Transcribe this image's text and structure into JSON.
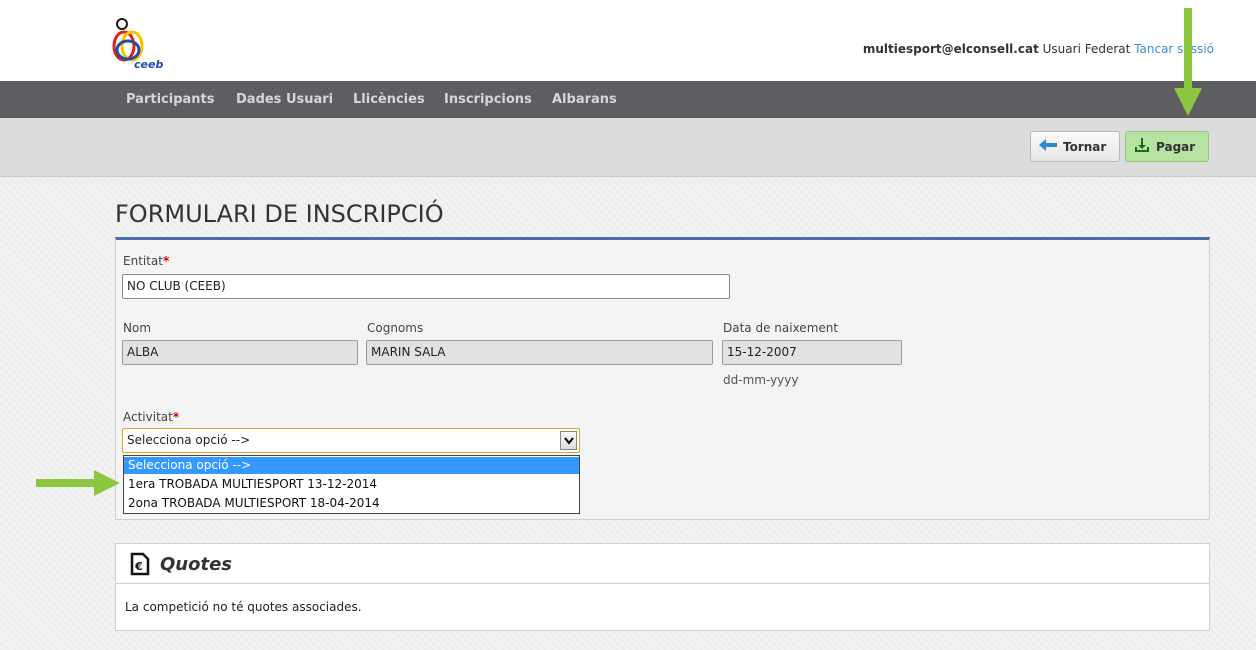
{
  "header": {
    "logo_text": "ceeb",
    "email": "multiesport@elconsell.cat",
    "role": "Usuari Federat",
    "logout_label": "Tancar sessió"
  },
  "nav": {
    "items": [
      {
        "label": "Participants"
      },
      {
        "label": "Dades Usuari"
      },
      {
        "label": "Llicències"
      },
      {
        "label": "Inscripcions"
      },
      {
        "label": "Albarans"
      }
    ]
  },
  "toolbar": {
    "back_label": "Tornar",
    "pay_label": "Pagar"
  },
  "page": {
    "title": "FORMULARI DE INSCRIPCIÓ"
  },
  "form": {
    "entitat": {
      "label": "Entitat",
      "required_mark": "*",
      "value": "NO CLUB (CEEB)"
    },
    "nom": {
      "label": "Nom",
      "value": "ALBA"
    },
    "cognoms": {
      "label": "Cognoms",
      "value": "MARIN SALA"
    },
    "data_naixement": {
      "label": "Data de naixement",
      "value": "15-12-2007",
      "hint": "dd-mm-yyyy"
    },
    "activitat": {
      "label": "Activitat",
      "required_mark": "*",
      "selected": "Selecciona opció -->",
      "options": [
        {
          "label": "Selecciona opció -->"
        },
        {
          "label": "1era TROBADA MULTIESPORT 13-12-2014"
        },
        {
          "label": "2ona TROBADA MULTIESPORT 18-04-2014"
        }
      ]
    }
  },
  "quotes": {
    "title": "Quotes",
    "message": "La competició no té quotes associades."
  },
  "colors": {
    "nav_bg": "#5c5e62",
    "accent_blue": "#4a6ea8",
    "pay_green": "#b6e3a1",
    "annotation_green": "#8dc63f",
    "link": "#3a8fd8"
  }
}
